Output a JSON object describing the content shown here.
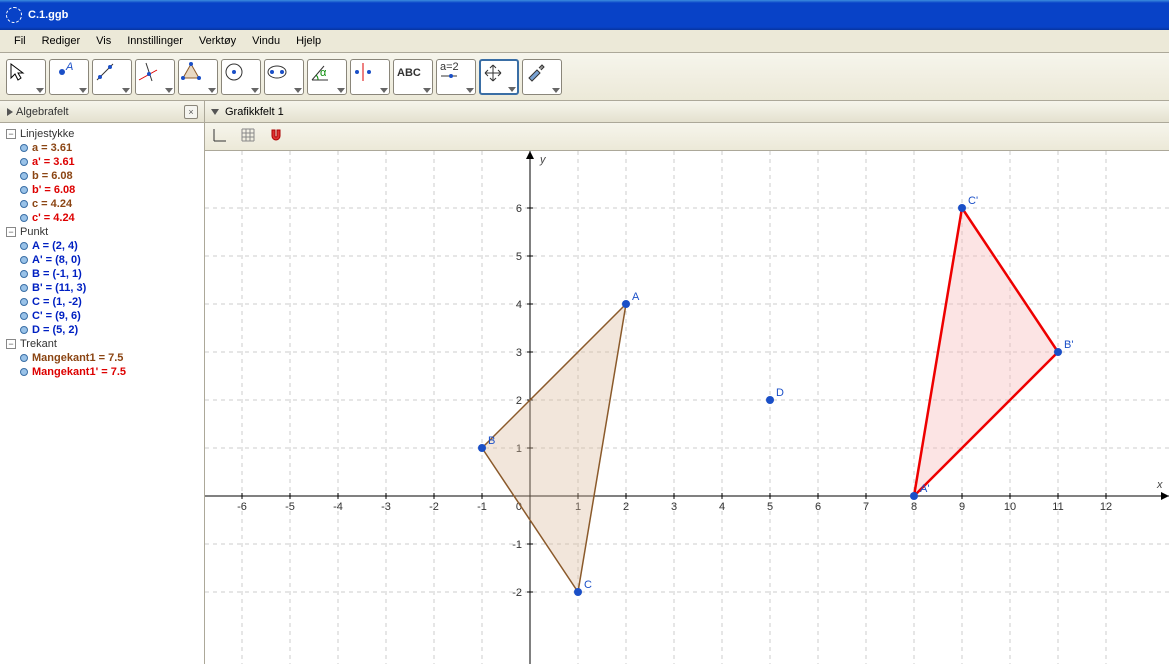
{
  "window": {
    "title": "C.1.ggb"
  },
  "menu": {
    "items": [
      "Fil",
      "Rediger",
      "Vis",
      "Innstillinger",
      "Verktøy",
      "Vindu",
      "Hjelp"
    ]
  },
  "algebra": {
    "title": "Algebrafelt",
    "groups": [
      {
        "label": "Linjestykke",
        "items": [
          {
            "text": "a = 3.61",
            "cls": "brown"
          },
          {
            "text": "a' = 3.61",
            "cls": "red"
          },
          {
            "text": "b = 6.08",
            "cls": "brown"
          },
          {
            "text": "b' = 6.08",
            "cls": "red"
          },
          {
            "text": "c = 4.24",
            "cls": "brown"
          },
          {
            "text": "c' = 4.24",
            "cls": "red"
          }
        ]
      },
      {
        "label": "Punkt",
        "items": [
          {
            "text": "A = (2, 4)",
            "cls": "blue"
          },
          {
            "text": "A' = (8, 0)",
            "cls": "blue"
          },
          {
            "text": "B = (-1, 1)",
            "cls": "blue"
          },
          {
            "text": "B' = (11, 3)",
            "cls": "blue"
          },
          {
            "text": "C = (1, -2)",
            "cls": "blue"
          },
          {
            "text": "C' = (9, 6)",
            "cls": "blue"
          },
          {
            "text": "D = (5, 2)",
            "cls": "blue"
          }
        ]
      },
      {
        "label": "Trekant",
        "items": [
          {
            "text": "Mangekant1 = 7.5",
            "cls": "brown"
          },
          {
            "text": "Mangekant1' = 7.5",
            "cls": "red"
          }
        ]
      }
    ]
  },
  "graphics": {
    "title": "Grafikkfelt 1"
  },
  "chart_data": {
    "type": "scatter",
    "title": "",
    "xlabel": "x",
    "ylabel": "y",
    "xlim": [
      -6,
      12
    ],
    "ylim": [
      -2,
      6
    ],
    "points": [
      {
        "name": "A",
        "x": 2,
        "y": 4
      },
      {
        "name": "A'",
        "x": 8,
        "y": 0
      },
      {
        "name": "B",
        "x": -1,
        "y": 1
      },
      {
        "name": "B'",
        "x": 11,
        "y": 3
      },
      {
        "name": "C",
        "x": 1,
        "y": -2
      },
      {
        "name": "C'",
        "x": 9,
        "y": 6
      },
      {
        "name": "D",
        "x": 5,
        "y": 2
      }
    ],
    "polygons": [
      {
        "name": "Mangekant1",
        "vertices": [
          "A",
          "B",
          "C"
        ],
        "stroke": "#8b5a2b",
        "fill": "#d9b899",
        "opacity": 0.35
      },
      {
        "name": "Mangekant1'",
        "vertices": [
          "A'",
          "B'",
          "C'"
        ],
        "stroke": "#e00",
        "fill": "#f7b3b3",
        "opacity": 0.35
      }
    ],
    "x_ticks": [
      -6,
      -5,
      -4,
      -3,
      -2,
      -1,
      0,
      1,
      2,
      3,
      4,
      5,
      6,
      7,
      8,
      9,
      10,
      11,
      12
    ],
    "y_ticks": [
      -2,
      -1,
      0,
      1,
      2,
      3,
      4,
      5,
      6
    ]
  },
  "toolbar_icons": [
    "move",
    "point",
    "line",
    "perp",
    "polygon",
    "circle",
    "ellipse",
    "angle",
    "reflect",
    "text",
    "slider",
    "translate-view",
    "tools"
  ]
}
